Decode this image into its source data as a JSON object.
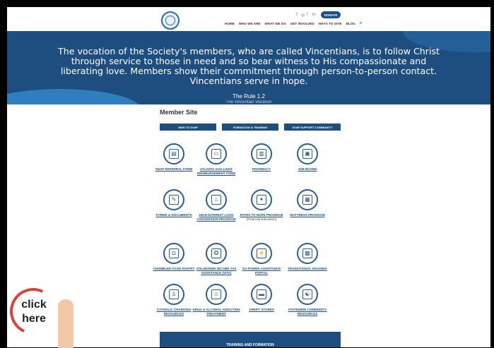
{
  "header": {
    "social_icons": [
      "facebook-icon",
      "instagram-icon",
      "twitter-icon",
      "linkedin-icon"
    ],
    "social_glyphs": [
      "f",
      "◎",
      "t",
      "in"
    ],
    "donate_label": "DONATE",
    "nav": [
      "HOME",
      "WHO WE ARE",
      "WHAT WE DO",
      "GET INVOLVED",
      "WAYS TO GIVE",
      "BLOG"
    ]
  },
  "hero": {
    "quote": "The vocation of the Society's members, who are called Vincentians, is to follow Christ through service to those in need and so bear witness to His compassionate and liberating love. Members show their commitment through person-to-person contact. Vincentians serve in hope.",
    "cite": "The Rule 1.2",
    "cut": "The Vincentian Vocation"
  },
  "member": {
    "title": "Member Site",
    "tabs": [
      "NEW TO SVdP",
      "FORMATION & TRAINING",
      "SVdP SUPPORT COMMUNITY"
    ],
    "items": [
      {
        "label": "SNAP REFERRAL FORM",
        "icon": "form-icon",
        "glyph": "▤"
      },
      {
        "label": "ATLANTA GAS LIGHT REIMBURSEMENT FORM",
        "icon": "gas-bill-icon",
        "glyph": "▭"
      },
      {
        "label": "PHARMACY",
        "icon": "pharmacy-icon",
        "glyph": "▥"
      },
      {
        "label": "JOB BOARD",
        "icon": "job-board-icon",
        "glyph": "▣"
      },
      {
        "label": "FORMS & DOCUMENTS",
        "icon": "documents-icon",
        "glyph": "✎"
      },
      {
        "label": "HIGH INTEREST LOAN CONVERSION PROGRAM",
        "icon": "loan-icon",
        "glyph": "⌂"
      },
      {
        "label": "PATHS TO HOPE PROGRAM",
        "sub": "(Financial Education)",
        "icon": "financial-education-icon",
        "glyph": "✦"
      },
      {
        "label": "MATTRESS PROGRAM",
        "icon": "mattress-icon",
        "glyph": "▦"
      },
      {
        "label": "CHAMBLEE FOOD PANTRY",
        "icon": "food-pantry-icon",
        "glyph": "◘"
      },
      {
        "label": "VOLUNTEER INCOME TAX ASSISTANCE (VITA)",
        "icon": "tax-icon",
        "glyph": "✪"
      },
      {
        "label": "GA POWER ASSISTANCE PORTAL",
        "icon": "power-icon",
        "glyph": "⚡"
      },
      {
        "label": "TRANSITIONAL HOUSING",
        "icon": "housing-icon",
        "glyph": "▩"
      },
      {
        "label": "CATHOLIC CHARITIES RESOURCES",
        "icon": "charities-icon",
        "glyph": "♙"
      },
      {
        "label": "DRUG & ALCOHOL ADDICTION TREATMENT",
        "icon": "addiction-treatment-icon",
        "glyph": "☺"
      },
      {
        "label": "THRIFT STORES",
        "icon": "thrift-store-icon",
        "glyph": "▬"
      },
      {
        "label": "STATEWIDE COMMUNITY RESOURCES",
        "icon": "community-resources-icon",
        "glyph": "☯"
      }
    ],
    "training_label": "TRAINING AND FORMATION"
  },
  "overlay": {
    "click_text": "click here"
  }
}
